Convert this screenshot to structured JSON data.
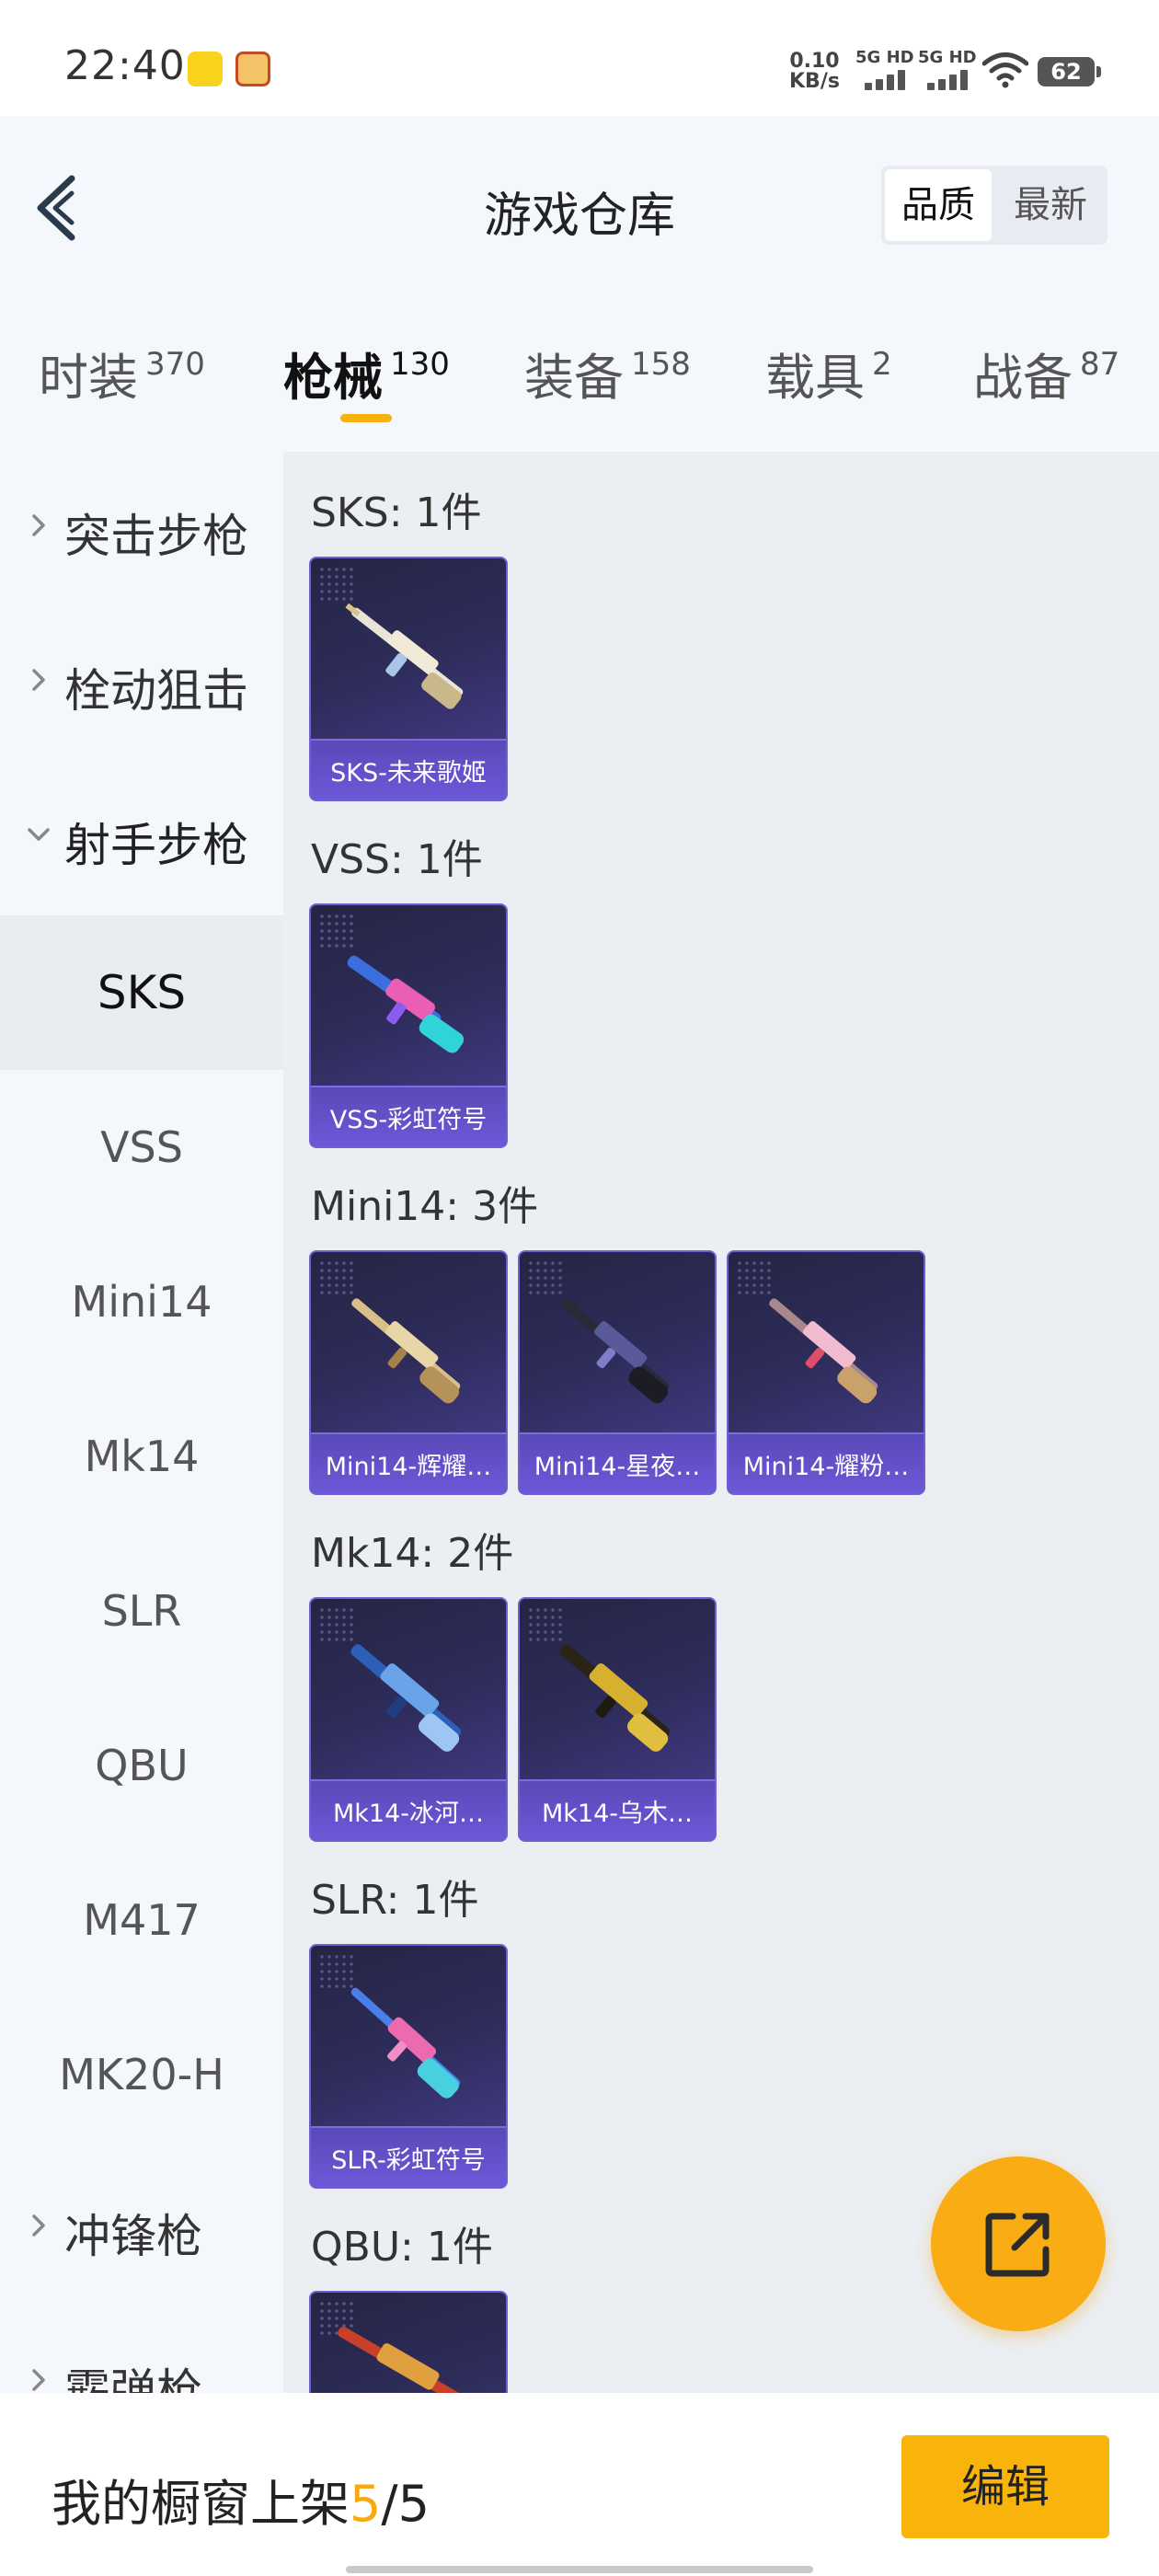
{
  "status_bar": {
    "time": "22:40",
    "net_speed_value": "0.10",
    "net_speed_unit": "KB/s",
    "sim1": "5G HD",
    "sim2": "5G HD",
    "battery": "62"
  },
  "header": {
    "title": "游戏仓库",
    "sort_options": [
      "品质",
      "最新"
    ],
    "active_sort": "品质"
  },
  "category_tabs": [
    {
      "label": "时装",
      "count": "370"
    },
    {
      "label": "枪械",
      "count": "130",
      "active": true
    },
    {
      "label": "装备",
      "count": "158"
    },
    {
      "label": "载具",
      "count": "2"
    },
    {
      "label": "战备",
      "count": "87"
    }
  ],
  "sidebar": {
    "groups": [
      {
        "label": "突击步枪",
        "expanded": false
      },
      {
        "label": "栓动狙击",
        "expanded": false
      },
      {
        "label": "射手步枪",
        "expanded": true
      },
      {
        "label": "冲锋枪",
        "expanded": false
      },
      {
        "label": "霰弹枪",
        "expanded": false
      }
    ],
    "sub_items": [
      "SKS",
      "VSS",
      "Mini14",
      "Mk14",
      "SLR",
      "QBU",
      "M417",
      "MK20-H"
    ],
    "active_sub": "SKS"
  },
  "sections": [
    {
      "title": "SKS: 1件",
      "items": [
        {
          "name": "SKS-未来歌姬",
          "icon": "rifle-white-gold"
        }
      ]
    },
    {
      "title": "VSS: 1件",
      "items": [
        {
          "name": "VSS-彩虹符号",
          "icon": "rifle-blue-pink"
        }
      ]
    },
    {
      "title": "Mini14: 3件",
      "items": [
        {
          "name": "Mini14-辉耀…",
          "icon": "rifle-gold"
        },
        {
          "name": "Mini14-星夜…",
          "icon": "rifle-dark-purple"
        },
        {
          "name": "Mini14-耀粉…",
          "icon": "rifle-pink-gold"
        }
      ]
    },
    {
      "title": "Mk14: 2件",
      "items": [
        {
          "name": "Mk14-冰河…",
          "icon": "rifle-blue"
        },
        {
          "name": "Mk14-乌木…",
          "icon": "rifle-black-gold"
        }
      ]
    },
    {
      "title": "SLR: 1件",
      "items": [
        {
          "name": "SLR-彩虹符号",
          "icon": "rifle-pink-blue"
        }
      ]
    },
    {
      "title": "QBU: 1件",
      "items": [
        {
          "name": "",
          "icon": "rifle-red-gold"
        }
      ]
    }
  ],
  "bottom_bar": {
    "label": "我的橱窗上架",
    "count_current": "5",
    "count_sep": "/",
    "count_total": "5",
    "edit_label": "编辑"
  },
  "colors": {
    "accent": "#f9b40c",
    "card_bg": "#2e2c5a",
    "card_label_bg": "#6d58d8"
  }
}
